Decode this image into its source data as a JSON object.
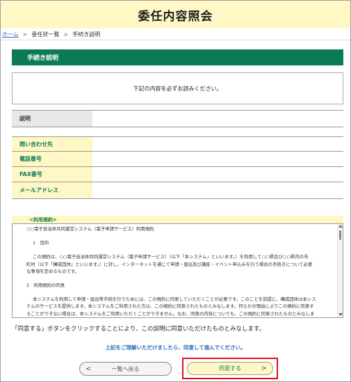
{
  "header": {
    "title": "委任内容照会"
  },
  "breadcrumb": {
    "home": "ホーム",
    "sep1": ">",
    "list": "委任状一覧",
    "sep2": ">",
    "current": "手続き説明"
  },
  "section": {
    "title": "手続き説明"
  },
  "notice": {
    "text": "下記の内容を必ずお読みください。"
  },
  "description": {
    "label": "説明"
  },
  "contact": {
    "heading": "問い合わせ先",
    "phone_label": "電話番号",
    "fax_label": "FAX番号",
    "email_label": "メールアドレス"
  },
  "terms": {
    "heading": "<利用規約>",
    "lines": [
      "○○電子自治体共同運営システム（電子申請サービス）利用規約",
      "1　目的",
      "この規約は、○○電子自治体共同運営システム（電子申請サービス）（以下「本システム」といいます。）を利用して○○県及び○○県内の市",
      "町村（以下「構成団体」といいます。）に対し、インターネットを通じて申請・届出及び講座・イベント申込みを行う場合の手続きについて必要",
      "な事項を定めるものです。",
      "2　利用規約の同意",
      "本システムを利用して申請・届出等手続を行うためには、この規約に同意していただくことが必要です。このことを前提に、構成団体は本シス",
      "テムのサービスを提供します。本システムをご利用された方は、この規約に同意されたものとみなします。何らかの理由によりこの規約に同意す",
      "ることができない場合は、本システムをご利用いただくことができません。なお、同意の内容についても、この規約に同意されたものとみなしま"
    ]
  },
  "agree_note": "「同意する」ボタンをクリックすることにより、この説明に同意いただけたものとみなします。",
  "proceed_note": "上記をご理解いただけましたら、同意して進んでください。",
  "buttons": {
    "back_label": "一覧へ戻る",
    "back_arrow": "<",
    "agree_label": "同意する",
    "agree_arrow": ">"
  },
  "colors": {
    "accent": "#0a7a57",
    "highlight": "#fff8c6",
    "link": "#2a6fba",
    "focus": "#e01010"
  }
}
